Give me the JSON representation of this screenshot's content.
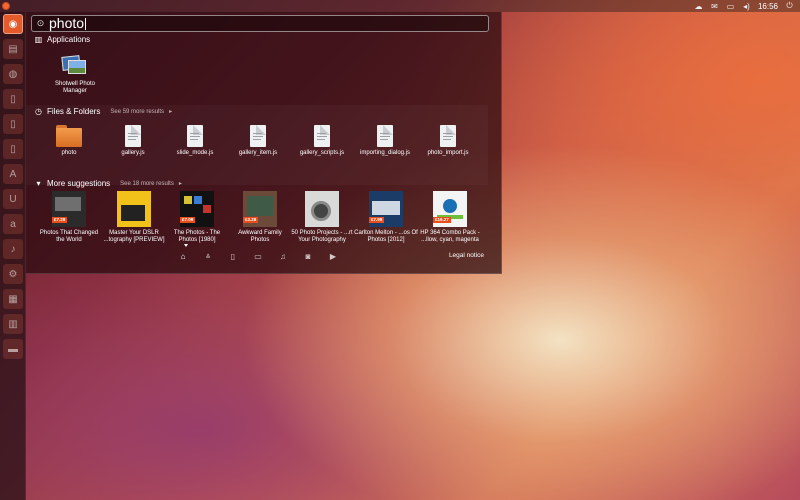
{
  "top_panel": {
    "indicators": [
      "cloud-icon",
      "mail-icon",
      "battery-icon",
      "volume-icon"
    ],
    "clock": "16:56"
  },
  "launcher": {
    "items": [
      "dash-home",
      "files",
      "firefox",
      "libreoffice-writer",
      "libreoffice-calc",
      "libreoffice-impress",
      "ubuntu-software-center",
      "ubuntu-one",
      "amazon",
      "ubuntu-one-music",
      "system-settings",
      "workspace-switcher",
      "trash"
    ]
  },
  "search": {
    "query": "photo"
  },
  "categories": {
    "applications": {
      "title": "Applications",
      "items": [
        {
          "label": "Shotwell Photo Manager",
          "icon": "shotwell-icon"
        }
      ]
    },
    "files": {
      "title": "Files & Folders",
      "more": "See 59 more results",
      "items": [
        {
          "label": "photo",
          "icon": "folder-icon"
        },
        {
          "label": "gallery.js",
          "icon": "document-icon"
        },
        {
          "label": "slide_mode.js",
          "icon": "document-icon"
        },
        {
          "label": "gallery_item.js",
          "icon": "document-icon"
        },
        {
          "label": "gallery_scripts.js",
          "icon": "document-icon"
        },
        {
          "label": "importing_dialog.js",
          "icon": "document-icon"
        },
        {
          "label": "photo_import.js",
          "icon": "document-icon"
        }
      ]
    },
    "suggestions": {
      "title": "More suggestions",
      "more": "See 18 more results",
      "items": [
        {
          "label": "Photos That Changed the World",
          "price": "£7.29",
          "color": "#2a2a2a"
        },
        {
          "label": "Master Your DSLR ...tography [PREVIEW]",
          "price": "",
          "color": "#f2c21b"
        },
        {
          "label": "The Photos - The Photos [1980]",
          "price": "£7.09",
          "color": "#111111"
        },
        {
          "label": "Awkward Family Photos",
          "price": "£3.28",
          "color": "#6b4a3a"
        },
        {
          "label": "50 Photo Projects - ...rt Your Photography",
          "price": "",
          "color": "#d9d9d9"
        },
        {
          "label": "Carlton Melton - ...os Of Photos [2012]",
          "price": "£7.99",
          "color": "#1a3c66"
        },
        {
          "label": "HP 364 Combo Pack - ...llow, cyan, magenta",
          "price": "£16.27",
          "color": "#f4f4f4"
        }
      ]
    }
  },
  "lens_bar": {
    "lenses": [
      "home-lens",
      "applications-lens",
      "files-lens",
      "social-lens",
      "music-lens",
      "photos-lens",
      "video-lens"
    ],
    "legal": "Legal notice"
  },
  "colors": {
    "accent": "#e35a2b",
    "dash_bg": "#280a0f"
  }
}
